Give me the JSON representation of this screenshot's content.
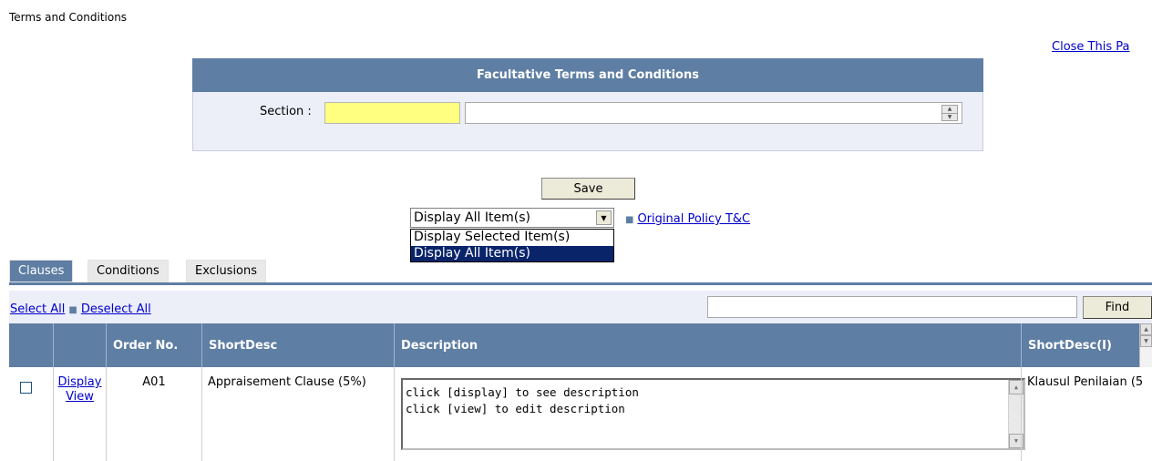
{
  "page_title": "Terms and Conditions",
  "close_link": "Close This Pa",
  "panel": {
    "title": "Facultative Terms and Conditions",
    "section_label": "Section :",
    "section_code_value": "",
    "section_desc_value": ""
  },
  "save_label": "Save",
  "display_filter": {
    "selected": "Display All Item(s)",
    "options": [
      "Display Selected Item(s)",
      "Display All Item(s)"
    ]
  },
  "original_policy_link": "Original Policy T&C",
  "tabs": [
    {
      "label": "Clauses",
      "active": true
    },
    {
      "label": "Conditions",
      "active": false
    },
    {
      "label": "Exclusions",
      "active": false
    }
  ],
  "select_all": "Select All",
  "deselect_all": "Deselect All",
  "find_input_value": "",
  "find_label": "Find",
  "grid": {
    "columns": [
      "",
      "",
      "Order No.",
      "ShortDesc",
      "Description",
      "ShortDesc(I)"
    ],
    "rows": [
      {
        "checked": false,
        "display_link": "Display",
        "view_link": "View",
        "order_no": "A01",
        "short_desc": "Appraisement Clause (5%)",
        "description_lines": [
          "click [display] to see description",
          "click [view] to edit description"
        ],
        "short_desc_i": "Klausul Penilaian (5"
      }
    ]
  },
  "colors": {
    "header_blue": "#5e7ea3",
    "panel_bg": "#eceef8",
    "required_yellow": "#ffff80",
    "selection_blue": "#0a246a"
  }
}
